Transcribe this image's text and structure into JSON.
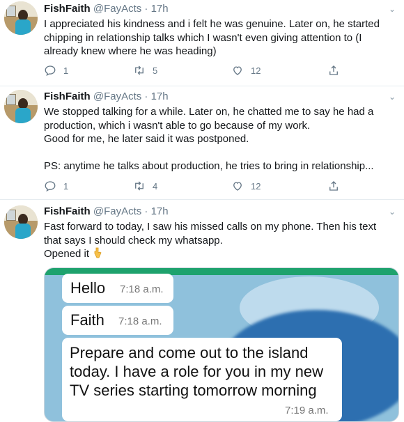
{
  "tweets": [
    {
      "name": "FishFaith",
      "handle": "@FayActs",
      "dot": "·",
      "time": "17h",
      "text": "I appreciated his kindness and i felt he was genuine. Later on, he started chipping in relationship talks which I wasn't even giving attention to (I already knew where he was heading)",
      "reply_count": "1",
      "retweet_count": "5",
      "like_count": "12"
    },
    {
      "name": "FishFaith",
      "handle": "@FayActs",
      "dot": "·",
      "time": "17h",
      "text": "We stopped talking for a while. Later on, he chatted me to say he had a production, which i wasn't able to go because of my work.\nGood for me, he later said it was postponed.\n\nPS: anytime he talks about production, he tries to bring in relationship...",
      "reply_count": "1",
      "retweet_count": "4",
      "like_count": "12"
    },
    {
      "name": "FishFaith",
      "handle": "@FayActs",
      "dot": "·",
      "time": "17h",
      "text": "Fast forward to today, I saw his missed calls on my phone. Then his text that says I should check my whatsapp.\nOpened it",
      "emoji": "point-down-emoji"
    }
  ],
  "media": {
    "bubbles": [
      {
        "text": "Hello",
        "time": "7:18 a.m."
      },
      {
        "text": "Faith",
        "time": "7:18 a.m."
      },
      {
        "text": "Prepare and come out to the island today. I have a role for you in my new TV series starting tomorrow morning",
        "time": "7:19 a.m."
      }
    ]
  },
  "colors": {
    "text": "#14171a",
    "secondary": "#657786",
    "divider": "#e6ecf0",
    "whatsapp_green": "#1ea26d"
  },
  "icons": [
    "reply-icon",
    "retweet-icon",
    "like-icon",
    "share-icon",
    "caret-down-icon"
  ]
}
